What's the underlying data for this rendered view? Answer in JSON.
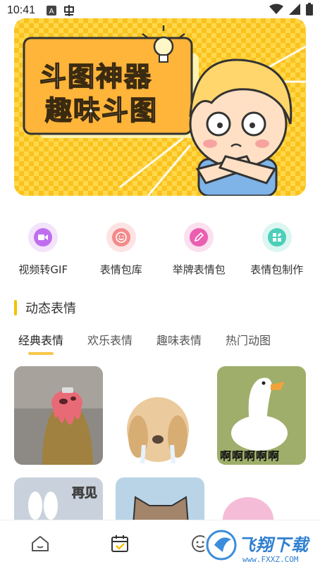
{
  "status_bar": {
    "time": "10:41"
  },
  "banner": {
    "line1": "斗图神器",
    "line2": "趣味斗图"
  },
  "tools": [
    {
      "label": "视频转GIF",
      "icon": "video-camera-icon",
      "color": "#c06ef0",
      "bg": "#f3e3fb"
    },
    {
      "label": "表情包库",
      "icon": "smiley-icon",
      "color": "#f38a8a",
      "bg": "#fde3e3"
    },
    {
      "label": "举牌表情包",
      "icon": "pencil-icon",
      "color": "#ea5fb0",
      "bg": "#fbe0ef"
    },
    {
      "label": "表情包制作",
      "icon": "grid-plus-icon",
      "color": "#4ccfb9",
      "bg": "#dcf6f1"
    }
  ],
  "section": {
    "title": "动态表情"
  },
  "tabs": [
    "经典表情",
    "欢乐表情",
    "趣味表情",
    "热门动图"
  ],
  "active_tab": "经典表情",
  "thumbs": {
    "duck_caption": "啊啊啊啊啊",
    "bunny_caption": "再见"
  },
  "bottom_nav": [
    "home-icon",
    "calendar-check-icon",
    "smiley-icon"
  ],
  "watermark": {
    "brand": "飞翔下载",
    "url": "www.FXXZ.COM"
  },
  "colors": {
    "accent": "#f5c200",
    "banner_bg": "#ffd23f",
    "banner_orange": "#ffb43a"
  }
}
